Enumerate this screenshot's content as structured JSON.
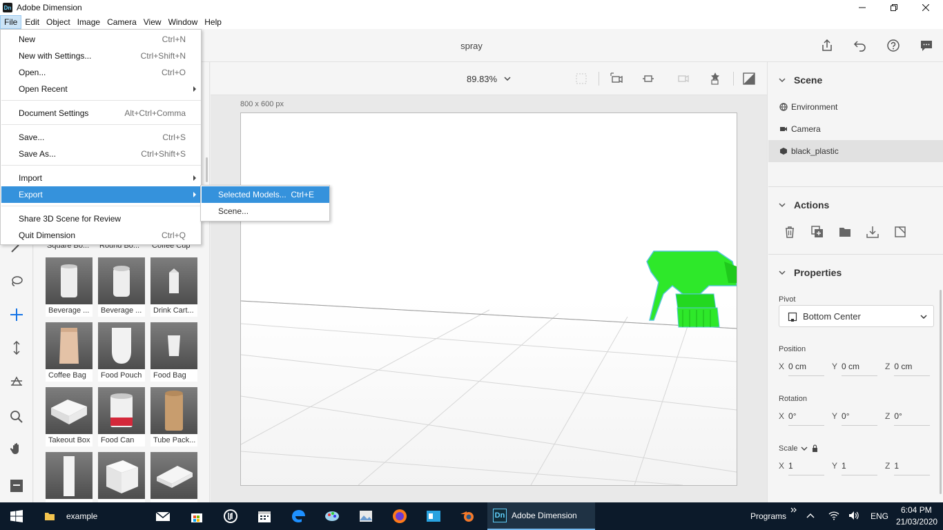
{
  "window": {
    "app_icon_text": "Dn",
    "title": "Adobe Dimension",
    "minimize": "—",
    "restore": "❐",
    "close": "✕"
  },
  "menubar": [
    "File",
    "Edit",
    "Object",
    "Image",
    "Camera",
    "View",
    "Window",
    "Help"
  ],
  "header": {
    "document_title": "spray"
  },
  "canvas": {
    "zoom": "89.83%",
    "size_label": "800 x 600 px"
  },
  "assets": {
    "hidden_row_labels": [
      "Square Bo...",
      "Round Bo...",
      "Coffee Cup"
    ],
    "items": [
      "Beverage ...",
      "Beverage ...",
      "Drink Cart...",
      "Coffee Bag",
      "Food Pouch",
      "Food Bag",
      "Takeout Box",
      "Food Can",
      "Tube Pack...",
      "",
      "",
      ""
    ]
  },
  "scene_panel": {
    "title": "Scene",
    "items": [
      "Environment",
      "Camera",
      "black_plastic"
    ],
    "selected": "black_plastic"
  },
  "actions_panel": {
    "title": "Actions"
  },
  "properties_panel": {
    "title": "Properties",
    "pivot_label": "Pivot",
    "pivot_value": "Bottom Center",
    "position_label": "Position",
    "position": {
      "x": "0 cm",
      "y": "0 cm",
      "z": "0 cm"
    },
    "rotation_label": "Rotation",
    "rotation": {
      "x": "0°",
      "y": "0°",
      "z": "0°"
    },
    "scale_label": "Scale",
    "scale": {
      "x": "1",
      "y": "1",
      "z": "1"
    },
    "axis": {
      "x": "X",
      "y": "Y",
      "z": "Z"
    }
  },
  "file_menu": {
    "items": [
      {
        "label": "New",
        "shortcut": "Ctrl+N"
      },
      {
        "label": "New with Settings...",
        "shortcut": "Ctrl+Shift+N"
      },
      {
        "label": "Open...",
        "shortcut": "Ctrl+O"
      },
      {
        "label": "Open Recent",
        "shortcut": ""
      },
      {
        "label": "Document Settings",
        "shortcut": "Alt+Ctrl+Comma"
      },
      {
        "label": "Save...",
        "shortcut": "Ctrl+S"
      },
      {
        "label": "Save As...",
        "shortcut": "Ctrl+Shift+S"
      },
      {
        "label": "Import",
        "shortcut": ""
      },
      {
        "label": "Export",
        "shortcut": ""
      },
      {
        "label": "Share 3D Scene for Review",
        "shortcut": ""
      },
      {
        "label": "Quit Dimension",
        "shortcut": "Ctrl+Q"
      }
    ],
    "highlighted": "Export"
  },
  "export_submenu": {
    "items": [
      {
        "label": "Selected Models...",
        "shortcut": "Ctrl+E"
      },
      {
        "label": "Scene...",
        "shortcut": ""
      }
    ]
  },
  "taskbar": {
    "folder_label": "example",
    "active_app_icon": "Dn",
    "active_app_label": "Adobe Dimension",
    "programs_label": "Programs",
    "language": "ENG",
    "time": "6:04 PM",
    "date": "21/03/2020"
  },
  "colors": {
    "accent": "#1473e6",
    "menu_highlight": "#3592dc",
    "selection_green": "#2ee82a",
    "taskbar_bg": "#0c1a2a"
  }
}
